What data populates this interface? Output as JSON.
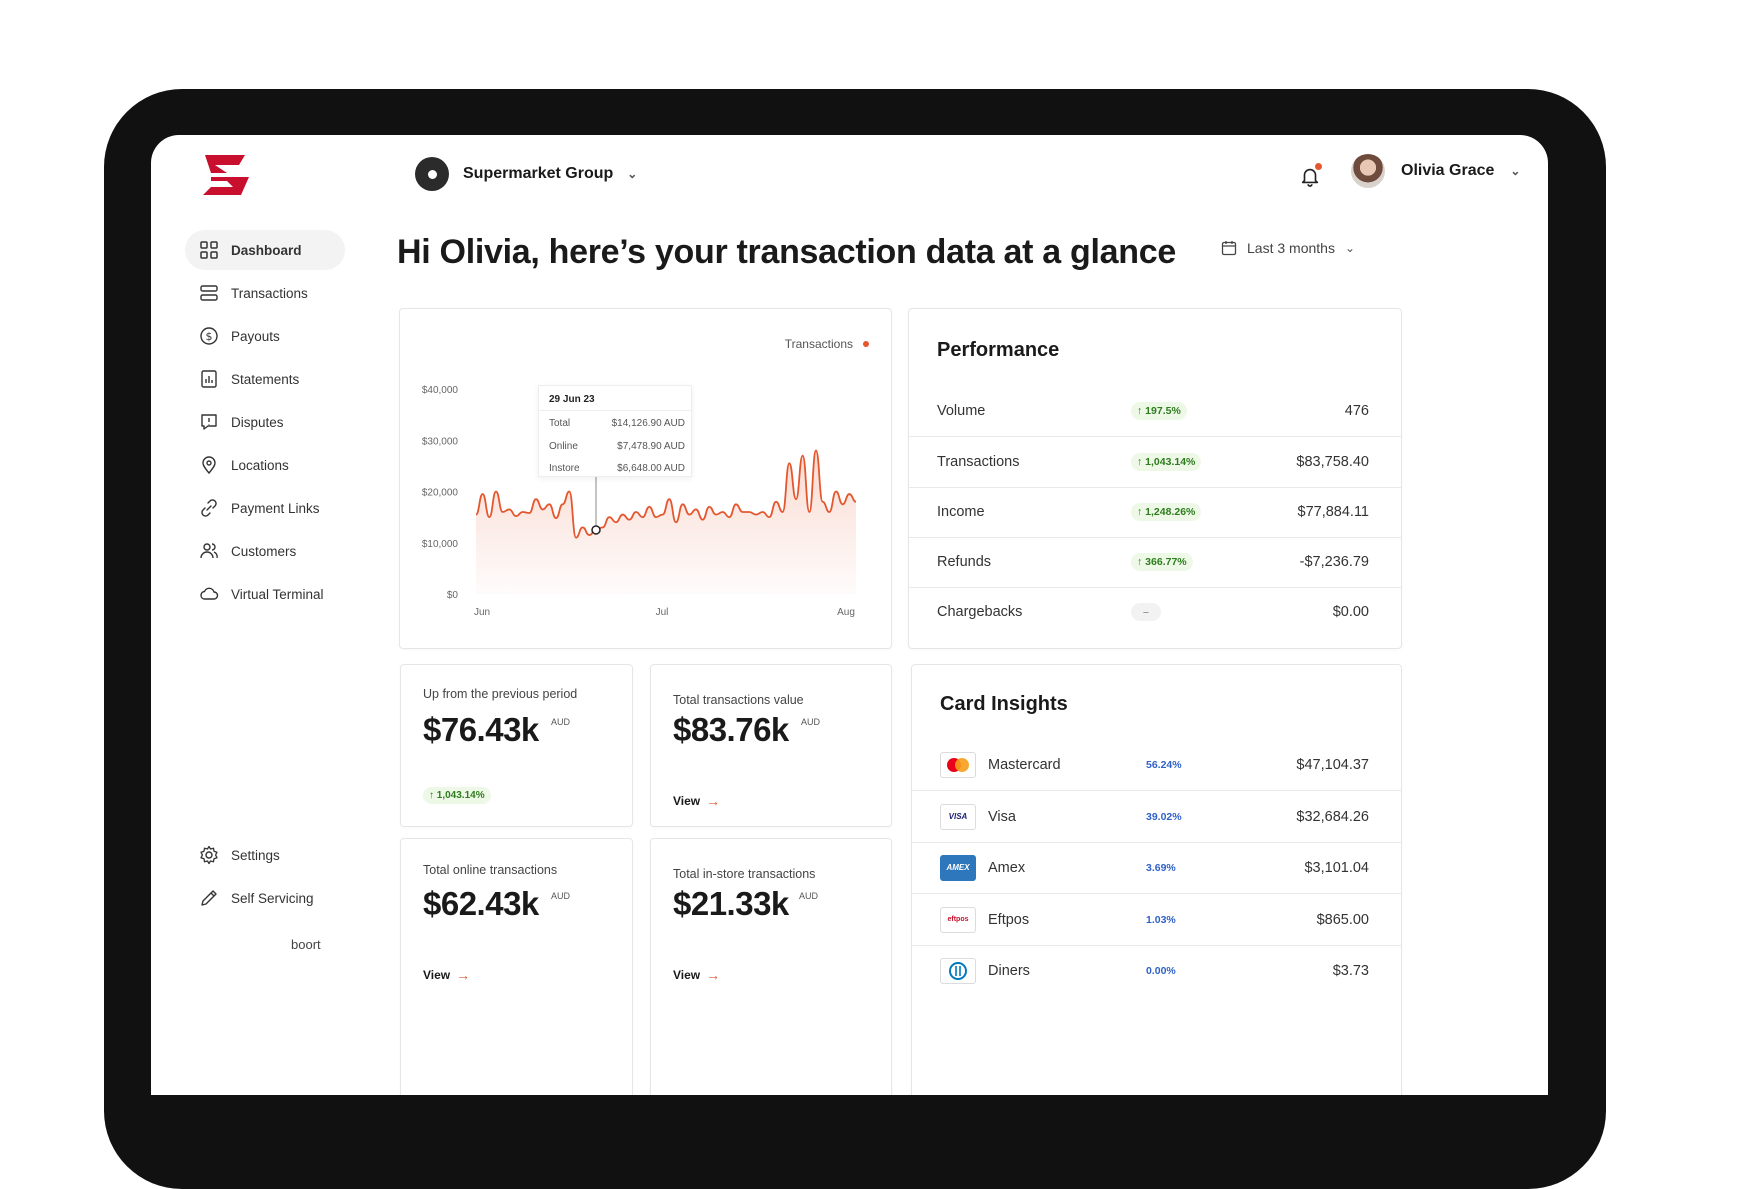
{
  "header": {
    "org_name": "Supermarket Group",
    "user_name": "Olivia Grace",
    "icons": [
      "brand-logo-icon",
      "org-icon",
      "bell-icon",
      "avatar",
      "chevron-down-icon"
    ]
  },
  "sidebar": {
    "items": [
      {
        "label": "Dashboard",
        "icon": "grid-icon",
        "active": true
      },
      {
        "label": "Transactions",
        "icon": "list-icon"
      },
      {
        "label": "Payouts",
        "icon": "dollar-circle-icon"
      },
      {
        "label": "Statements",
        "icon": "chart-doc-icon"
      },
      {
        "label": "Disputes",
        "icon": "speech-alert-icon"
      },
      {
        "label": "Locations",
        "icon": "pin-icon"
      },
      {
        "label": "Payment Links",
        "icon": "link-icon"
      },
      {
        "label": "Customers",
        "icon": "users-icon"
      },
      {
        "label": "Virtual Terminal",
        "icon": "cloud-icon"
      }
    ],
    "bottom": [
      {
        "label": "Settings",
        "icon": "gear-icon"
      },
      {
        "label": "Self Servicing",
        "icon": "pen-icon"
      }
    ],
    "powered_by": "boort"
  },
  "main": {
    "greeting": "Hi Olivia, here’s your transaction data at a glance",
    "date_range": "Last 3 months"
  },
  "chart_data": {
    "type": "area",
    "legend": "Transactions",
    "yticks": [
      "$40,000",
      "$30,000",
      "$20,000",
      "$10,000",
      "$0"
    ],
    "xticks": [
      "Jun",
      "Jul",
      "Aug"
    ],
    "ylim": [
      0,
      40000
    ],
    "x_range": [
      "2023-06-01",
      "2023-08-31"
    ],
    "series": [
      {
        "color": "#e4572e",
        "values": [
          15500,
          19500,
          15000,
          20000,
          16000,
          16500,
          15200,
          16000,
          15800,
          18500,
          16500,
          17500,
          14800,
          17500,
          20000,
          11000,
          13000,
          11500,
          12500,
          13000,
          15000,
          14000,
          15500,
          14500,
          16000,
          15000,
          17000,
          15000,
          15500,
          18500,
          14000,
          17500,
          15500,
          16500,
          14500,
          17000,
          15500,
          16000,
          15000,
          17500,
          16000,
          16000,
          15500,
          16000,
          15000,
          18000,
          16000,
          25500,
          18500,
          27000,
          16000,
          28000,
          18000,
          16000,
          20000,
          17500,
          19500,
          18000
        ]
      }
    ],
    "tooltip": {
      "date": "29 Jun 23",
      "rows": [
        {
          "label": "Total",
          "value": "$14,126.90 AUD"
        },
        {
          "label": "Online",
          "value": "$7,478.90 AUD"
        },
        {
          "label": "Instore",
          "value": "$6,648.00 AUD"
        }
      ],
      "highlight_index": 18
    }
  },
  "performance": {
    "title": "Performance",
    "rows": [
      {
        "label": "Volume",
        "change": "197.5%",
        "value": "476"
      },
      {
        "label": "Transactions",
        "change": "1,043.14%",
        "value": "$83,758.40"
      },
      {
        "label": "Income",
        "change": "1,248.26%",
        "value": "$77,884.11"
      },
      {
        "label": "Refunds",
        "change": "366.77%",
        "value": "-$7,236.79"
      },
      {
        "label": "Chargebacks",
        "change": "–",
        "value": "$0.00"
      }
    ]
  },
  "stats": [
    {
      "label": "Up from the previous period",
      "value": "$76.43k",
      "unit": "AUD",
      "badge": "1,043.14%"
    },
    {
      "label": "Total transactions value",
      "value": "$83.76k",
      "unit": "AUD",
      "link": "View"
    },
    {
      "label": "Total online transactions",
      "value": "$62.43k",
      "unit": "AUD",
      "link": "View"
    },
    {
      "label": "Total in-store transactions",
      "value": "$21.33k",
      "unit": "AUD",
      "link": "View"
    }
  ],
  "card_insights": {
    "title": "Card Insights",
    "rows": [
      {
        "name": "Mastercard",
        "pct": "56.24%",
        "value": "$47,104.37",
        "logo_text": ""
      },
      {
        "name": "Visa",
        "pct": "39.02%",
        "value": "$32,684.26",
        "logo_text": "VISA"
      },
      {
        "name": "Amex",
        "pct": "3.69%",
        "value": "$3,101.04",
        "logo_text": "AMEX"
      },
      {
        "name": "Eftpos",
        "pct": "1.03%",
        "value": "$865.00",
        "logo_text": "eftpos"
      },
      {
        "name": "Diners",
        "pct": "0.00%",
        "value": "$3.73",
        "logo_text": ""
      }
    ]
  },
  "colors": {
    "accent": "#e4572e",
    "brand": "#c8102e",
    "positive": "#2d7d1e",
    "link_blue": "#2f62c8"
  }
}
